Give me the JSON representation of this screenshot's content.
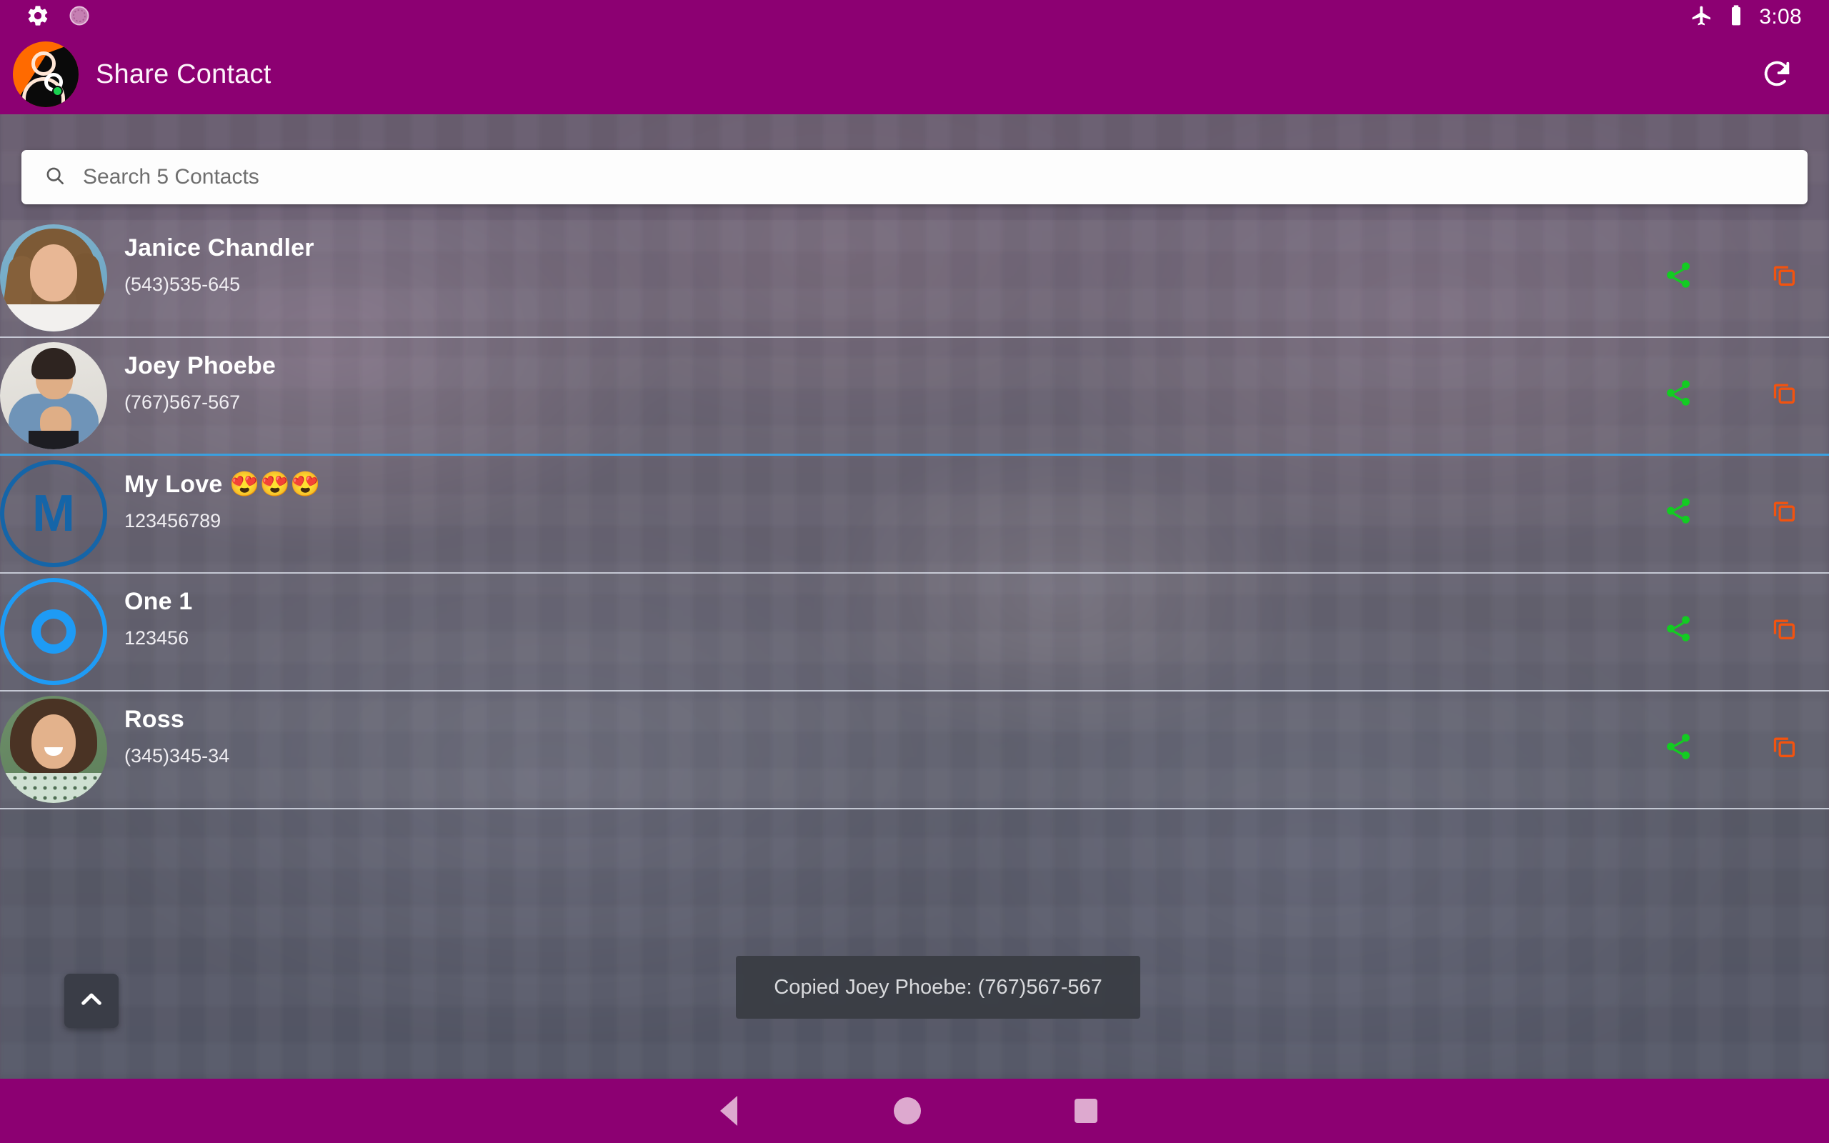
{
  "status_bar": {
    "icons": [
      "gear-icon",
      "sync-circle-icon",
      "airplane-mode-icon",
      "battery-icon"
    ],
    "time": "3:08",
    "background_color": "#8c0072"
  },
  "app_bar": {
    "logo_icon": "share-contact-app-logo",
    "title": "Share Contact",
    "refresh_label": "refresh-icon",
    "background_color": "#8c0072"
  },
  "search": {
    "placeholder": "Search 5 Contacts",
    "value": "",
    "icon": "search-icon"
  },
  "contacts": [
    {
      "name": "Janice Chandler",
      "number": "(543)535-645",
      "avatar_type": "photo",
      "avatar_name": "avatar-janice-chandler",
      "share_icon": "share-icon",
      "copy_icon": "copy-icon",
      "highlighted": false
    },
    {
      "name": "Joey Phoebe",
      "number": "(767)567-567",
      "avatar_type": "photo",
      "avatar_name": "avatar-joey-phoebe",
      "share_icon": "share-icon",
      "copy_icon": "copy-icon",
      "highlighted": true
    },
    {
      "name": "My Love 😍😍😍",
      "number": "123456789",
      "avatar_type": "monogram",
      "avatar_initial": "M",
      "avatar_name": "avatar-my-love",
      "share_icon": "share-icon",
      "copy_icon": "copy-icon",
      "highlighted": false
    },
    {
      "name": "One 1",
      "number": "123456",
      "avatar_type": "monogram-ring",
      "avatar_initial": "O",
      "avatar_name": "avatar-one-1",
      "share_icon": "share-icon",
      "copy_icon": "copy-icon",
      "highlighted": false
    },
    {
      "name": "Ross",
      "number": "(345)345-34",
      "avatar_type": "photo",
      "avatar_name": "avatar-ross",
      "share_icon": "share-icon",
      "copy_icon": "copy-icon",
      "highlighted": false
    }
  ],
  "scroll_top_button": {
    "icon": "chevron-up-icon"
  },
  "toast": {
    "message": "Copied Joey Phoebe: (767)567-567"
  },
  "nav_bar": {
    "back": "back-triangle-icon",
    "home": "home-circle-icon",
    "recents": "recents-square-icon",
    "background_color": "#8c0072"
  },
  "colors": {
    "accent": "#8c0072",
    "share_icon": "#13cc22",
    "copy_icon": "#f2530f",
    "monogram_dark": "#1565a8",
    "monogram_bright": "#1e9bf5",
    "row_divider_highlight": "#3aa0e0"
  }
}
